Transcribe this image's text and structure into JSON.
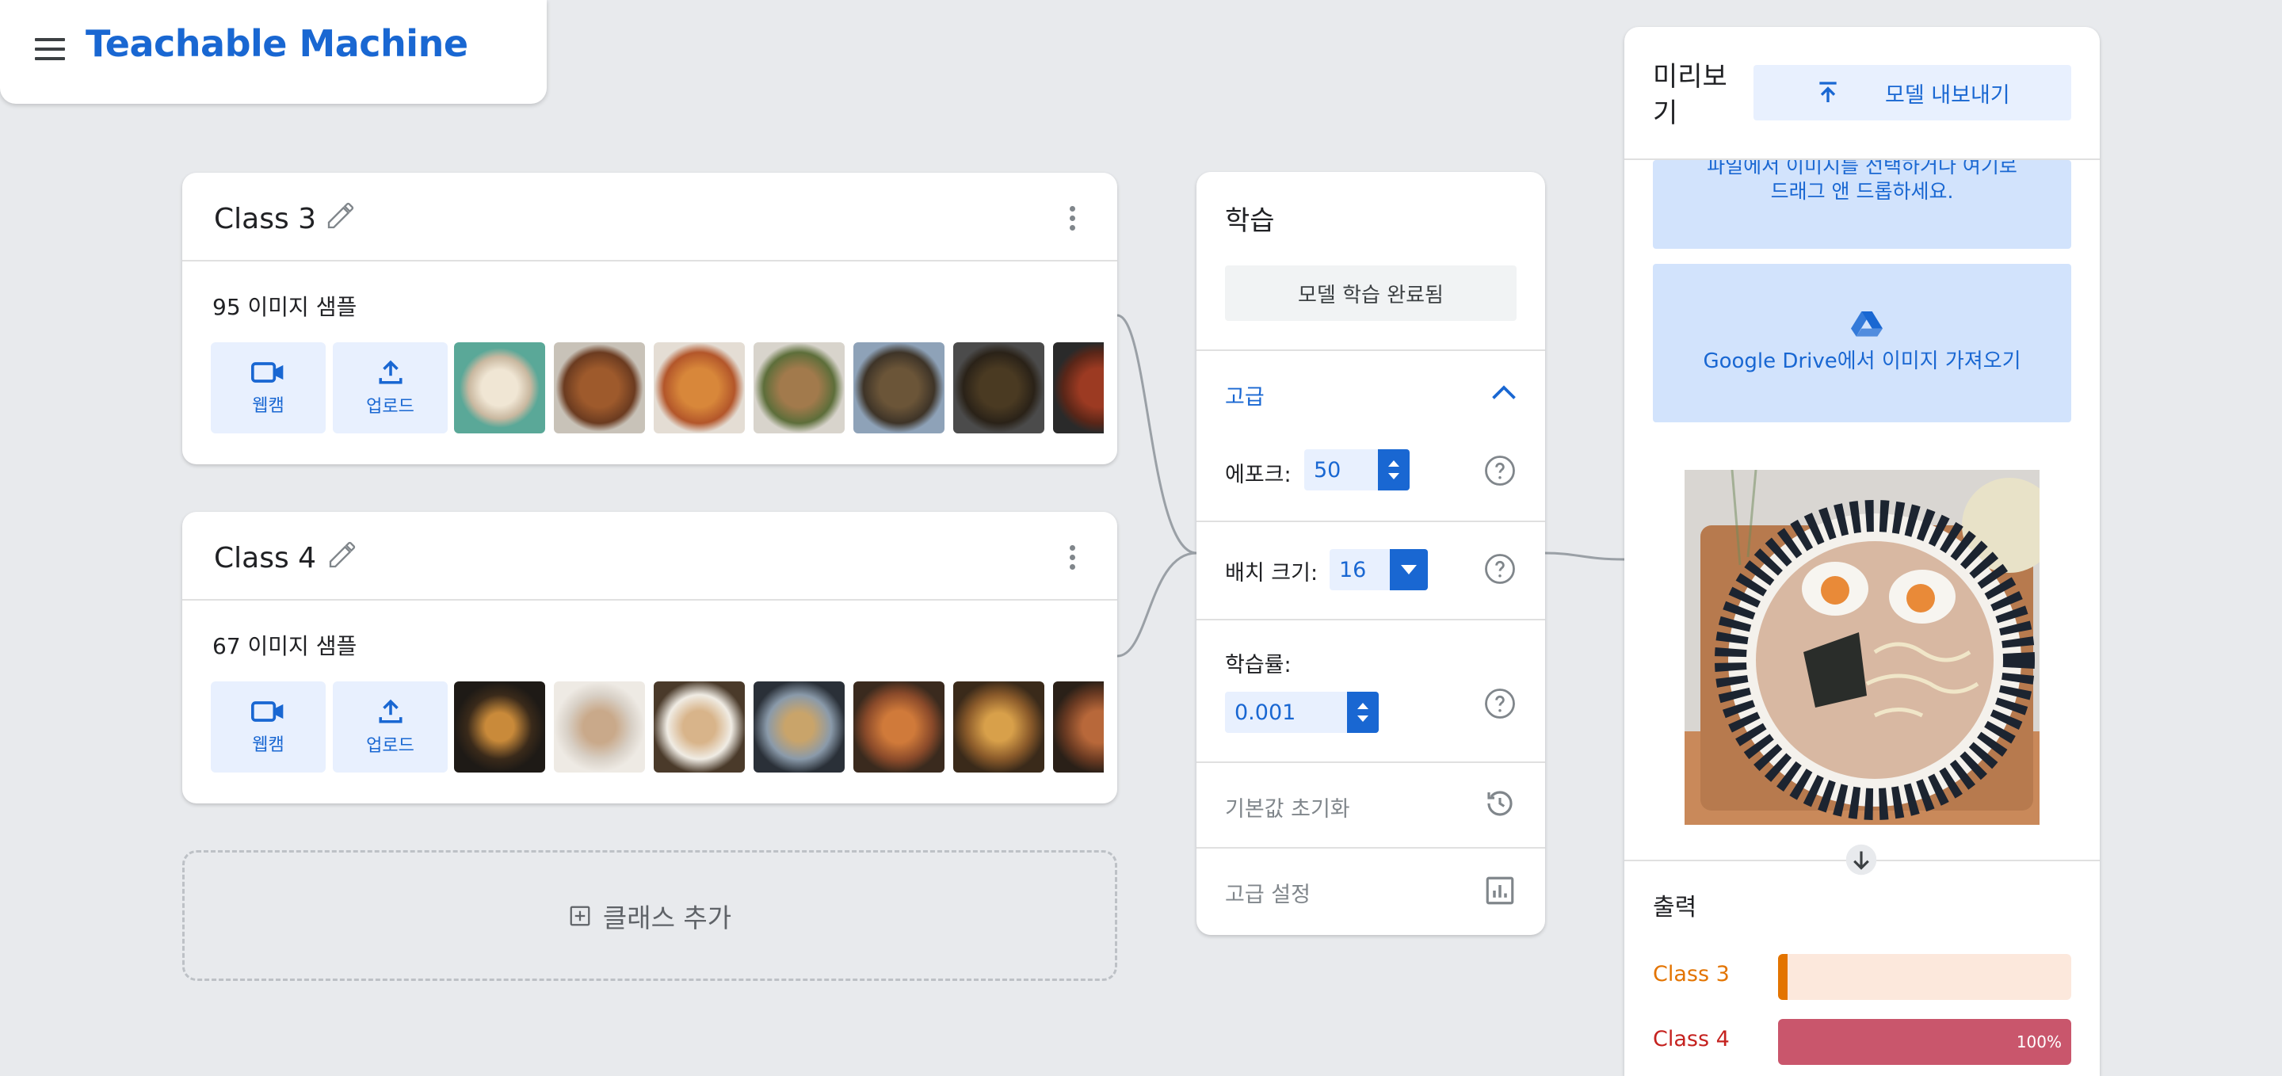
{
  "header": {
    "app_title": "Teachable Machine"
  },
  "classes": [
    {
      "name": "Class 3",
      "sample_count": "95 이미지 샘플",
      "webcam_label": "웹캠",
      "upload_label": "업로드"
    },
    {
      "name": "Class 4",
      "sample_count": "67 이미지 샘플",
      "webcam_label": "웹캠",
      "upload_label": "업로드"
    }
  ],
  "add_class_label": "클래스 추가",
  "training": {
    "title": "학습",
    "trained_button": "모델 학습 완료됨",
    "advanced_label": "고급",
    "epochs_label": "에포크:",
    "epochs_value": "50",
    "batch_label": "배치 크기:",
    "batch_value": "16",
    "lr_label": "학습률:",
    "lr_value": "0.001",
    "reset_label": "기본값 초기화",
    "advanced_settings_label": "고급 설정"
  },
  "preview": {
    "title": "미리보기",
    "export_label": "모델 내보내기",
    "drop_line1": "파일에서 이미지를 선택하거나 여기로",
    "drop_line2": "드래그 앤 드롭하세요.",
    "gdrive_label": "Google Drive에서 이미지 가져오기",
    "output_title": "출력",
    "outputs": [
      {
        "label": "Class 3",
        "percent": 0,
        "percent_text": "",
        "color": "#e37400",
        "track": "#fce8dc"
      },
      {
        "label": "Class 4",
        "percent": 100,
        "percent_text": "100%",
        "color": "#c5221f",
        "fill": "#c9566c"
      }
    ]
  },
  "colors": {
    "accent": "#1967d2",
    "light_accent": "#e8f0fe",
    "background": "#e8eaed"
  }
}
